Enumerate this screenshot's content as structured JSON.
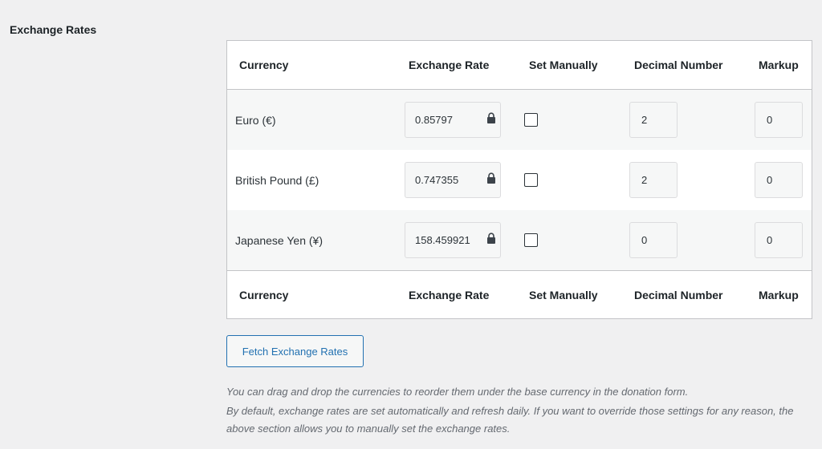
{
  "section_label": "Exchange Rates",
  "table": {
    "headers": {
      "currency": "Currency",
      "exchange_rate": "Exchange Rate",
      "set_manually": "Set Manually",
      "decimal_number": "Decimal Number",
      "markup": "Markup"
    },
    "rows": [
      {
        "currency": "Euro (€)",
        "rate": "0.85797",
        "set_manually": false,
        "decimal": "2",
        "markup": "0"
      },
      {
        "currency": "British Pound (£)",
        "rate": "0.747355",
        "set_manually": false,
        "decimal": "2",
        "markup": "0"
      },
      {
        "currency": "Japanese Yen (¥)",
        "rate": "158.459921",
        "set_manually": false,
        "decimal": "0",
        "markup": "0"
      }
    ]
  },
  "fetch_button": "Fetch Exchange Rates",
  "help": {
    "line1": "You can drag and drop the currencies to reorder them under the base currency in the donation form.",
    "line2": "By default, exchange rates are set automatically and refresh daily. If you want to override those settings for any reason, the above section allows you to manually set the exchange rates."
  },
  "icons": {
    "lock": "lock-icon"
  },
  "colors": {
    "accent": "#2271b1",
    "text": "#1d2327",
    "muted": "#646970"
  }
}
